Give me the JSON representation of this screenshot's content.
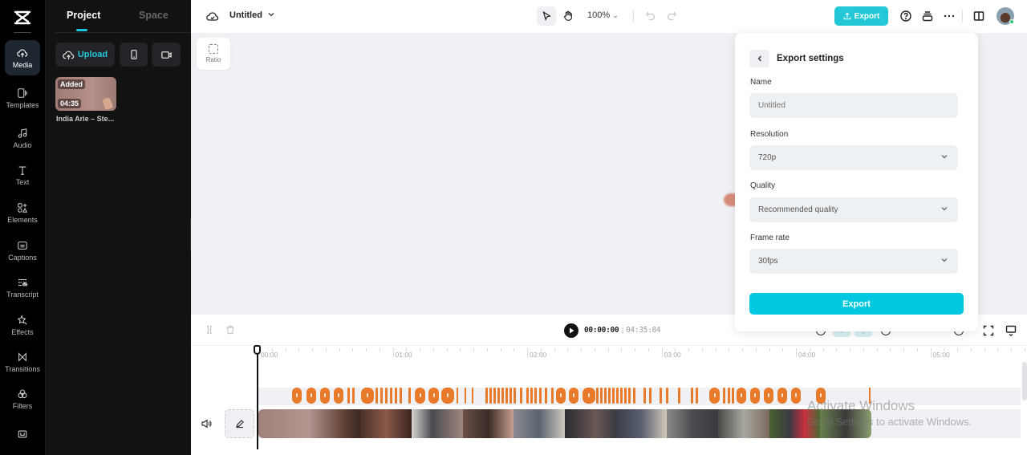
{
  "rail": {
    "items": [
      {
        "label": "Media",
        "icon": "cloud-upload-icon",
        "active": true
      },
      {
        "label": "Templates",
        "icon": "templates-icon"
      },
      {
        "label": "Audio",
        "icon": "music-note-icon"
      },
      {
        "label": "Text",
        "icon": "text-t-icon"
      },
      {
        "label": "Elements",
        "icon": "elements-icon"
      },
      {
        "label": "Captions",
        "icon": "captions-icon"
      },
      {
        "label": "Transcript",
        "icon": "transcript-icon"
      },
      {
        "label": "Effects",
        "icon": "effects-star-icon"
      },
      {
        "label": "Transitions",
        "icon": "transitions-icon"
      },
      {
        "label": "Filters",
        "icon": "filters-icon"
      }
    ],
    "bottom_icon": "keyboard-shortcuts-icon"
  },
  "panel": {
    "tabs": [
      "Project",
      "Space"
    ],
    "active_tab": "Project",
    "upload_label": "Upload",
    "media": [
      {
        "badge": "Added",
        "duration": "04:35",
        "name": "India Arie – Ste..."
      }
    ]
  },
  "topbar": {
    "title": "Untitled",
    "zoom": "100%",
    "export_label": "Export"
  },
  "canvas": {
    "ratio_label": "Ratio"
  },
  "export_settings": {
    "title": "Export settings",
    "name_label": "Name",
    "name_placeholder": "Untitled",
    "resolution_label": "Resolution",
    "resolution_value": "720p",
    "quality_label": "Quality",
    "quality_value": "Recommended quality",
    "framerate_label": "Frame rate",
    "framerate_value": "30fps",
    "export_button": "Export"
  },
  "playback": {
    "current_time": "00:00:00",
    "separator": "|",
    "total_time": "04:35:04"
  },
  "ruler": {
    "labels": [
      "00:00",
      "01:00",
      "02:00",
      "03:00",
      "04:00",
      "05:00"
    ]
  },
  "colors": {
    "accent": "#00c8e0",
    "beat_marker": "#e97a2a",
    "rail_bg": "#000000",
    "panel_bg": "#121212",
    "canvas_bg": "#eff1f4"
  },
  "watermark": {
    "line1": "Activate Windows",
    "line2": "Go to Settings to activate Windows."
  }
}
